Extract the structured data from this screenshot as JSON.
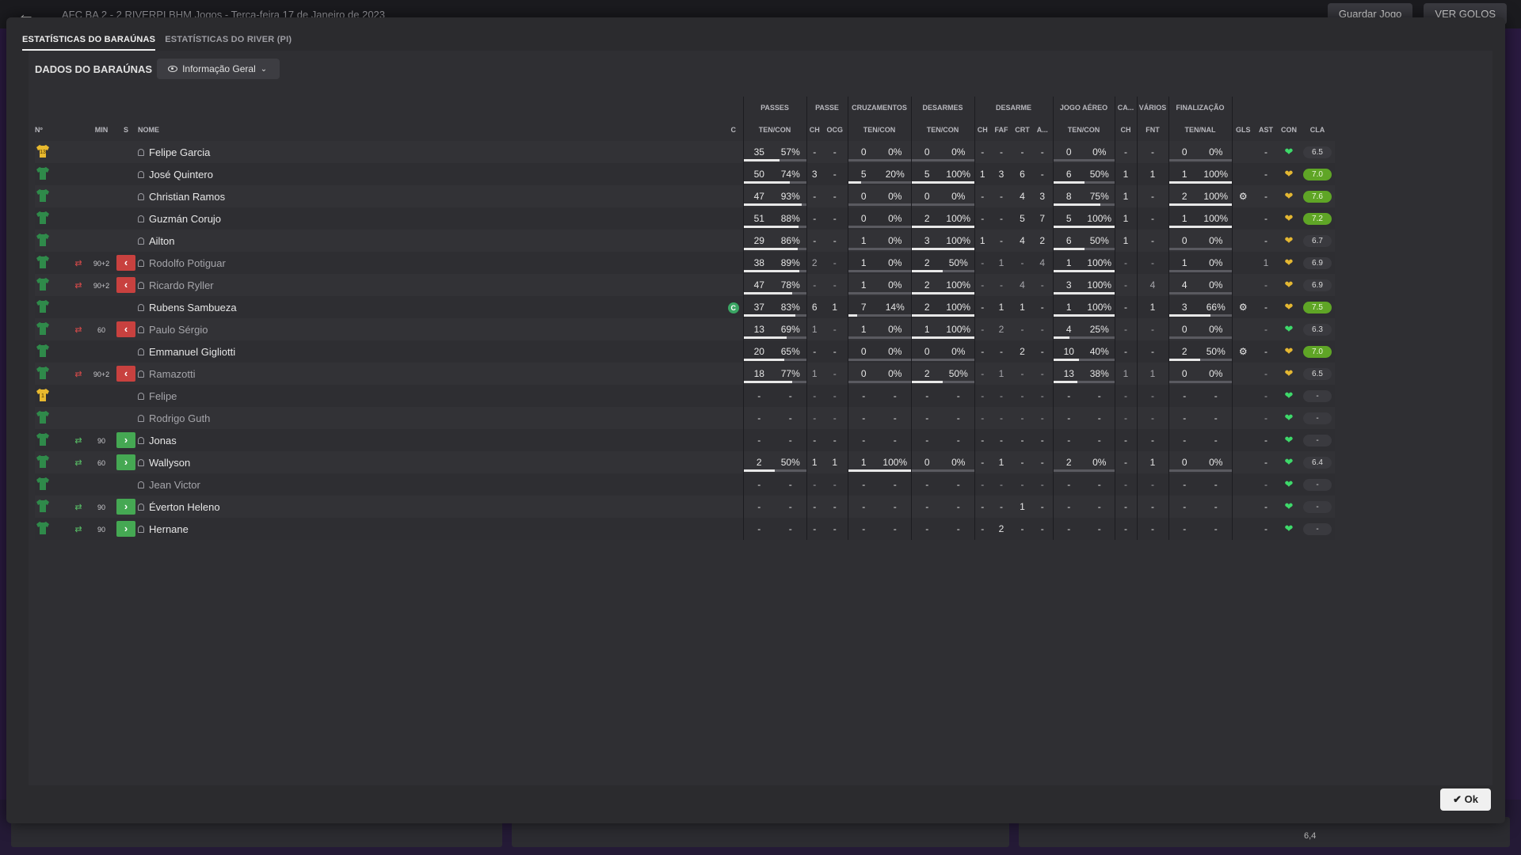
{
  "bg": {
    "match": "AFC BA 2 - 2 RIVERPI BHM Jogos - Terça-feira 17 de Janeiro de 2023",
    "save_game": "Guardar Jogo",
    "view_goals": "VER GOLOS",
    "bottom_val": "6,4"
  },
  "tabs": [
    {
      "label": "ESTATÍSTICAS DO BARAÚNAS",
      "active": true
    },
    {
      "label": "ESTATÍSTICAS DO RIVER (PI)",
      "active": false
    }
  ],
  "header": {
    "title": "DADOS DO BARAÚNAS",
    "dropdown": "Informação Geral"
  },
  "groups": [
    "PASSES",
    "PASSE",
    "CRUZAMENTOS",
    "DESARMES",
    "DESARME",
    "JOGO AÉREO",
    "CA...",
    "VÁRIOS",
    "FINALIZAÇÃO"
  ],
  "columns": {
    "no": "Nº",
    "min": "MIN",
    "s": "S",
    "name": "NOME",
    "c": "C",
    "passes": "TEN/CON",
    "passe_ch": "CH",
    "passe_ocg": "OCG",
    "cruz": "TEN/CON",
    "desarmes": "TEN/CON",
    "des_ch": "CH",
    "des_faf": "FAF",
    "des_crt": "CRT",
    "des_a": "A...",
    "aereo": "TEN/CON",
    "ca_ch": "CH",
    "var_fnt": "FNT",
    "fin": "TEN/NAL",
    "gls": "GLS",
    "ast": "AST",
    "con": "CON",
    "cla": "CLA"
  },
  "rows": [
    {
      "shirt": "gk",
      "num": "13",
      "arrow": "",
      "min": "",
      "sub": "",
      "name": "Felipe Garcia",
      "cap": "",
      "p_t": "35",
      "p_p": "57%",
      "p_pct": 0.57,
      "ch": "-",
      "ocg": "-",
      "cr_t": "0",
      "cr_p": "0%",
      "cr_pct": 0,
      "de_t": "0",
      "de_p": "0%",
      "de_pct": 0,
      "d_ch": "-",
      "faf": "-",
      "crt": "-",
      "a": "-",
      "ae_t": "0",
      "ae_p": "0%",
      "ae_pct": 0,
      "ca": "-",
      "fnt": "-",
      "f_t": "0",
      "f_p": "0%",
      "f_pct": 0,
      "gls": "",
      "ast": "-",
      "heart": "green",
      "rating": "6.5",
      "hi": false,
      "dim": false
    },
    {
      "shirt": "out",
      "num": "",
      "arrow": "",
      "min": "",
      "sub": "",
      "name": "José Quintero",
      "cap": "",
      "p_t": "50",
      "p_p": "74%",
      "p_pct": 0.74,
      "ch": "3",
      "ocg": "-",
      "cr_t": "5",
      "cr_p": "20%",
      "cr_pct": 0.2,
      "de_t": "5",
      "de_p": "100%",
      "de_pct": 1,
      "d_ch": "1",
      "faf": "3",
      "crt": "6",
      "a": "-",
      "ae_t": "6",
      "ae_p": "50%",
      "ae_pct": 0.5,
      "ca": "1",
      "fnt": "1",
      "f_t": "1",
      "f_p": "100%",
      "f_pct": 1,
      "gls": "",
      "ast": "-",
      "heart": "yellow",
      "rating": "7.0",
      "hi": true,
      "dim": false
    },
    {
      "shirt": "out",
      "num": "",
      "arrow": "",
      "min": "",
      "sub": "",
      "name": "Christian Ramos",
      "cap": "",
      "p_t": "47",
      "p_p": "93%",
      "p_pct": 0.93,
      "ch": "-",
      "ocg": "-",
      "cr_t": "0",
      "cr_p": "0%",
      "cr_pct": 0,
      "de_t": "0",
      "de_p": "0%",
      "de_pct": 0,
      "d_ch": "-",
      "faf": "-",
      "crt": "4",
      "a": "3",
      "ae_t": "8",
      "ae_p": "75%",
      "ae_pct": 0.75,
      "ca": "1",
      "fnt": "-",
      "f_t": "2",
      "f_p": "100%",
      "f_pct": 1,
      "gls": "gear",
      "ast": "-",
      "heart": "yellow",
      "rating": "7.6",
      "hi": true,
      "dim": false
    },
    {
      "shirt": "out",
      "num": "",
      "arrow": "",
      "min": "",
      "sub": "",
      "name": "Guzmán Corujo",
      "cap": "",
      "p_t": "51",
      "p_p": "88%",
      "p_pct": 0.88,
      "ch": "-",
      "ocg": "-",
      "cr_t": "0",
      "cr_p": "0%",
      "cr_pct": 0,
      "de_t": "2",
      "de_p": "100%",
      "de_pct": 1,
      "d_ch": "-",
      "faf": "-",
      "crt": "5",
      "a": "7",
      "ae_t": "5",
      "ae_p": "100%",
      "ae_pct": 1,
      "ca": "1",
      "fnt": "-",
      "f_t": "1",
      "f_p": "100%",
      "f_pct": 1,
      "gls": "",
      "ast": "-",
      "heart": "yellow",
      "rating": "7.2",
      "hi": true,
      "dim": false
    },
    {
      "shirt": "out",
      "num": "",
      "arrow": "",
      "min": "",
      "sub": "",
      "name": "Ailton",
      "cap": "",
      "p_t": "29",
      "p_p": "86%",
      "p_pct": 0.86,
      "ch": "-",
      "ocg": "-",
      "cr_t": "1",
      "cr_p": "0%",
      "cr_pct": 0,
      "de_t": "3",
      "de_p": "100%",
      "de_pct": 1,
      "d_ch": "1",
      "faf": "-",
      "crt": "4",
      "a": "2",
      "ae_t": "6",
      "ae_p": "50%",
      "ae_pct": 0.5,
      "ca": "1",
      "fnt": "-",
      "f_t": "0",
      "f_p": "0%",
      "f_pct": 0,
      "gls": "",
      "ast": "-",
      "heart": "yellow",
      "rating": "6.7",
      "hi": false,
      "dim": false
    },
    {
      "shirt": "out",
      "num": "",
      "arrow": "out",
      "min": "90+2",
      "sub": "out",
      "name": "Rodolfo Potiguar",
      "cap": "",
      "p_t": "38",
      "p_p": "89%",
      "p_pct": 0.89,
      "ch": "2",
      "ocg": "-",
      "cr_t": "1",
      "cr_p": "0%",
      "cr_pct": 0,
      "de_t": "2",
      "de_p": "50%",
      "de_pct": 0.5,
      "d_ch": "-",
      "faf": "1",
      "crt": "-",
      "a": "4",
      "ae_t": "1",
      "ae_p": "100%",
      "ae_pct": 1,
      "ca": "-",
      "fnt": "-",
      "f_t": "1",
      "f_p": "0%",
      "f_pct": 0,
      "gls": "",
      "ast": "1",
      "heart": "yellow",
      "rating": "6.9",
      "hi": false,
      "dim": true
    },
    {
      "shirt": "out",
      "num": "",
      "arrow": "out",
      "min": "90+2",
      "sub": "out",
      "name": "Ricardo Ryller",
      "cap": "",
      "p_t": "47",
      "p_p": "78%",
      "p_pct": 0.78,
      "ch": "-",
      "ocg": "-",
      "cr_t": "1",
      "cr_p": "0%",
      "cr_pct": 0,
      "de_t": "2",
      "de_p": "100%",
      "de_pct": 1,
      "d_ch": "-",
      "faf": "-",
      "crt": "4",
      "a": "-",
      "ae_t": "3",
      "ae_p": "100%",
      "ae_pct": 1,
      "ca": "-",
      "fnt": "4",
      "f_t": "4",
      "f_p": "0%",
      "f_pct": 0,
      "gls": "",
      "ast": "-",
      "heart": "yellow",
      "rating": "6.9",
      "hi": false,
      "dim": true
    },
    {
      "shirt": "out",
      "num": "",
      "arrow": "",
      "min": "",
      "sub": "",
      "name": "Rubens Sambueza",
      "cap": "C",
      "p_t": "37",
      "p_p": "83%",
      "p_pct": 0.83,
      "ch": "6",
      "ocg": "1",
      "cr_t": "7",
      "cr_p": "14%",
      "cr_pct": 0.14,
      "de_t": "2",
      "de_p": "100%",
      "de_pct": 1,
      "d_ch": "-",
      "faf": "1",
      "crt": "1",
      "a": "-",
      "ae_t": "1",
      "ae_p": "100%",
      "ae_pct": 1,
      "ca": "-",
      "fnt": "1",
      "f_t": "3",
      "f_p": "66%",
      "f_pct": 0.66,
      "gls": "gear",
      "ast": "-",
      "heart": "yellow",
      "rating": "7.5",
      "hi": true,
      "dim": false
    },
    {
      "shirt": "out",
      "num": "",
      "arrow": "out",
      "min": "60",
      "sub": "out",
      "name": "Paulo Sérgio",
      "cap": "",
      "p_t": "13",
      "p_p": "69%",
      "p_pct": 0.69,
      "ch": "1",
      "ocg": "-",
      "cr_t": "1",
      "cr_p": "0%",
      "cr_pct": 0,
      "de_t": "1",
      "de_p": "100%",
      "de_pct": 1,
      "d_ch": "-",
      "faf": "2",
      "crt": "-",
      "a": "-",
      "ae_t": "4",
      "ae_p": "25%",
      "ae_pct": 0.25,
      "ca": "-",
      "fnt": "-",
      "f_t": "0",
      "f_p": "0%",
      "f_pct": 0,
      "gls": "",
      "ast": "-",
      "heart": "green",
      "rating": "6.3",
      "hi": false,
      "dim": true
    },
    {
      "shirt": "out",
      "num": "",
      "arrow": "",
      "min": "",
      "sub": "",
      "name": "Emmanuel Gigliotti",
      "cap": "",
      "p_t": "20",
      "p_p": "65%",
      "p_pct": 0.65,
      "ch": "-",
      "ocg": "-",
      "cr_t": "0",
      "cr_p": "0%",
      "cr_pct": 0,
      "de_t": "0",
      "de_p": "0%",
      "de_pct": 0,
      "d_ch": "-",
      "faf": "-",
      "crt": "2",
      "a": "-",
      "ae_t": "10",
      "ae_p": "40%",
      "ae_pct": 0.4,
      "ca": "-",
      "fnt": "-",
      "f_t": "2",
      "f_p": "50%",
      "f_pct": 0.5,
      "gls": "gear",
      "ast": "-",
      "heart": "yellow",
      "rating": "7.0",
      "hi": true,
      "dim": false
    },
    {
      "shirt": "out",
      "num": "",
      "arrow": "out",
      "min": "90+2",
      "sub": "out",
      "name": "Ramazotti",
      "cap": "",
      "p_t": "18",
      "p_p": "77%",
      "p_pct": 0.77,
      "ch": "1",
      "ocg": "-",
      "cr_t": "0",
      "cr_p": "0%",
      "cr_pct": 0,
      "de_t": "2",
      "de_p": "50%",
      "de_pct": 0.5,
      "d_ch": "-",
      "faf": "1",
      "crt": "-",
      "a": "-",
      "ae_t": "13",
      "ae_p": "38%",
      "ae_pct": 0.38,
      "ca": "1",
      "fnt": "1",
      "f_t": "0",
      "f_p": "0%",
      "f_pct": 0,
      "gls": "",
      "ast": "-",
      "heart": "yellow",
      "rating": "6.5",
      "hi": false,
      "dim": true
    },
    {
      "shirt": "gk",
      "num": "1",
      "arrow": "",
      "min": "",
      "sub": "",
      "name": "Felipe",
      "cap": "",
      "p_t": "-",
      "p_p": "-",
      "p_pct": -1,
      "ch": "-",
      "ocg": "-",
      "cr_t": "-",
      "cr_p": "-",
      "cr_pct": -1,
      "de_t": "-",
      "de_p": "-",
      "de_pct": -1,
      "d_ch": "-",
      "faf": "-",
      "crt": "-",
      "a": "-",
      "ae_t": "-",
      "ae_p": "-",
      "ae_pct": -1,
      "ca": "-",
      "fnt": "-",
      "f_t": "-",
      "f_p": "-",
      "f_pct": -1,
      "gls": "",
      "ast": "-",
      "heart": "green",
      "rating": "-",
      "hi": false,
      "dim": true
    },
    {
      "shirt": "out",
      "num": "",
      "arrow": "",
      "min": "",
      "sub": "",
      "name": "Rodrigo Guth",
      "cap": "",
      "p_t": "-",
      "p_p": "-",
      "p_pct": -1,
      "ch": "-",
      "ocg": "-",
      "cr_t": "-",
      "cr_p": "-",
      "cr_pct": -1,
      "de_t": "-",
      "de_p": "-",
      "de_pct": -1,
      "d_ch": "-",
      "faf": "-",
      "crt": "-",
      "a": "-",
      "ae_t": "-",
      "ae_p": "-",
      "ae_pct": -1,
      "ca": "-",
      "fnt": "-",
      "f_t": "-",
      "f_p": "-",
      "f_pct": -1,
      "gls": "",
      "ast": "-",
      "heart": "green",
      "rating": "-",
      "hi": false,
      "dim": true
    },
    {
      "shirt": "out",
      "num": "",
      "arrow": "in",
      "min": "90",
      "sub": "in",
      "name": "Jonas",
      "cap": "",
      "p_t": "-",
      "p_p": "-",
      "p_pct": -1,
      "ch": "-",
      "ocg": "-",
      "cr_t": "-",
      "cr_p": "-",
      "cr_pct": -1,
      "de_t": "-",
      "de_p": "-",
      "de_pct": -1,
      "d_ch": "-",
      "faf": "-",
      "crt": "-",
      "a": "-",
      "ae_t": "-",
      "ae_p": "-",
      "ae_pct": -1,
      "ca": "-",
      "fnt": "-",
      "f_t": "-",
      "f_p": "-",
      "f_pct": -1,
      "gls": "",
      "ast": "-",
      "heart": "green",
      "rating": "-",
      "hi": false,
      "dim": false
    },
    {
      "shirt": "out",
      "num": "",
      "arrow": "in",
      "min": "60",
      "sub": "in",
      "name": "Wallyson",
      "cap": "",
      "p_t": "2",
      "p_p": "50%",
      "p_pct": 0.5,
      "ch": "1",
      "ocg": "1",
      "cr_t": "1",
      "cr_p": "100%",
      "cr_pct": 1,
      "de_t": "0",
      "de_p": "0%",
      "de_pct": 0,
      "d_ch": "-",
      "faf": "1",
      "crt": "-",
      "a": "-",
      "ae_t": "2",
      "ae_p": "0%",
      "ae_pct": 0,
      "ca": "-",
      "fnt": "1",
      "f_t": "0",
      "f_p": "0%",
      "f_pct": 0,
      "gls": "",
      "ast": "-",
      "heart": "green",
      "rating": "6.4",
      "hi": false,
      "dim": false
    },
    {
      "shirt": "out",
      "num": "",
      "arrow": "",
      "min": "",
      "sub": "",
      "name": "Jean Victor",
      "cap": "",
      "p_t": "-",
      "p_p": "-",
      "p_pct": -1,
      "ch": "-",
      "ocg": "-",
      "cr_t": "-",
      "cr_p": "-",
      "cr_pct": -1,
      "de_t": "-",
      "de_p": "-",
      "de_pct": -1,
      "d_ch": "-",
      "faf": "-",
      "crt": "-",
      "a": "-",
      "ae_t": "-",
      "ae_p": "-",
      "ae_pct": -1,
      "ca": "-",
      "fnt": "-",
      "f_t": "-",
      "f_p": "-",
      "f_pct": -1,
      "gls": "",
      "ast": "-",
      "heart": "green",
      "rating": "-",
      "hi": false,
      "dim": true
    },
    {
      "shirt": "out",
      "num": "",
      "arrow": "in",
      "min": "90",
      "sub": "in",
      "name": "Éverton Heleno",
      "cap": "",
      "p_t": "-",
      "p_p": "-",
      "p_pct": -1,
      "ch": "-",
      "ocg": "-",
      "cr_t": "-",
      "cr_p": "-",
      "cr_pct": -1,
      "de_t": "-",
      "de_p": "-",
      "de_pct": -1,
      "d_ch": "-",
      "faf": "-",
      "crt": "1",
      "a": "-",
      "ae_t": "-",
      "ae_p": "-",
      "ae_pct": -1,
      "ca": "-",
      "fnt": "-",
      "f_t": "-",
      "f_p": "-",
      "f_pct": -1,
      "gls": "",
      "ast": "-",
      "heart": "green",
      "rating": "-",
      "hi": false,
      "dim": false
    },
    {
      "shirt": "out",
      "num": "",
      "arrow": "in",
      "min": "90",
      "sub": "in",
      "name": "Hernane",
      "cap": "",
      "p_t": "-",
      "p_p": "-",
      "p_pct": -1,
      "ch": "-",
      "ocg": "-",
      "cr_t": "-",
      "cr_p": "-",
      "cr_pct": -1,
      "de_t": "-",
      "de_p": "-",
      "de_pct": -1,
      "d_ch": "-",
      "faf": "2",
      "crt": "-",
      "a": "-",
      "ae_t": "-",
      "ae_p": "-",
      "ae_pct": -1,
      "ca": "-",
      "fnt": "-",
      "f_t": "-",
      "f_p": "-",
      "f_pct": -1,
      "gls": "",
      "ast": "-",
      "heart": "green",
      "rating": "-",
      "hi": false,
      "dim": false
    }
  ],
  "ok_label": "Ok",
  "colors": {
    "accent_green": "#5fa526",
    "sub_out": "#c8413f",
    "sub_in": "#45a853",
    "heart_green": "#3ed96a",
    "heart_yellow": "#e4b732",
    "shirt": "#2f8a4a",
    "gk_shirt": "#e8b92e"
  }
}
